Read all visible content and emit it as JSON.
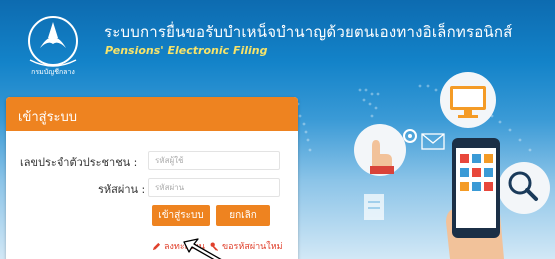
{
  "header": {
    "title_th": "ระบบการยื่นขอรับบำเหน็จบำนาญด้วยตนเองทางอิเล็กทรอนิกส์",
    "title_en": "Pensions' Electronic Filing",
    "seal_text": "กรมบัญชีกลาง"
  },
  "login": {
    "title": "เข้าสู่ระบบ",
    "id_label": "เลขประจำตัวประชาชน :",
    "id_placeholder": "รหัสผู้ใช้",
    "password_label": "รหัสผ่าน :",
    "password_placeholder": "รหัสผ่าน",
    "submit_label": "เข้าสู่ระบบ",
    "cancel_label": "ยกเลิก",
    "register_label": "ลงทะเบียน",
    "forgot_label": "ขอรหัสผ่านใหม่"
  },
  "colors": {
    "accent": "#ee8320",
    "brand_blue": "#1383c9",
    "subtitle_yellow": "#f6e36a",
    "link_red": "#e0402c"
  },
  "icons": [
    "seal-logo-icon",
    "pencil-icon",
    "key-icon",
    "cursor-arrow-icon",
    "monitor-icon",
    "mail-icon",
    "magnifier-icon",
    "smartphone-icon",
    "touch-hand-icon",
    "gear-icon",
    "document-icon"
  ]
}
